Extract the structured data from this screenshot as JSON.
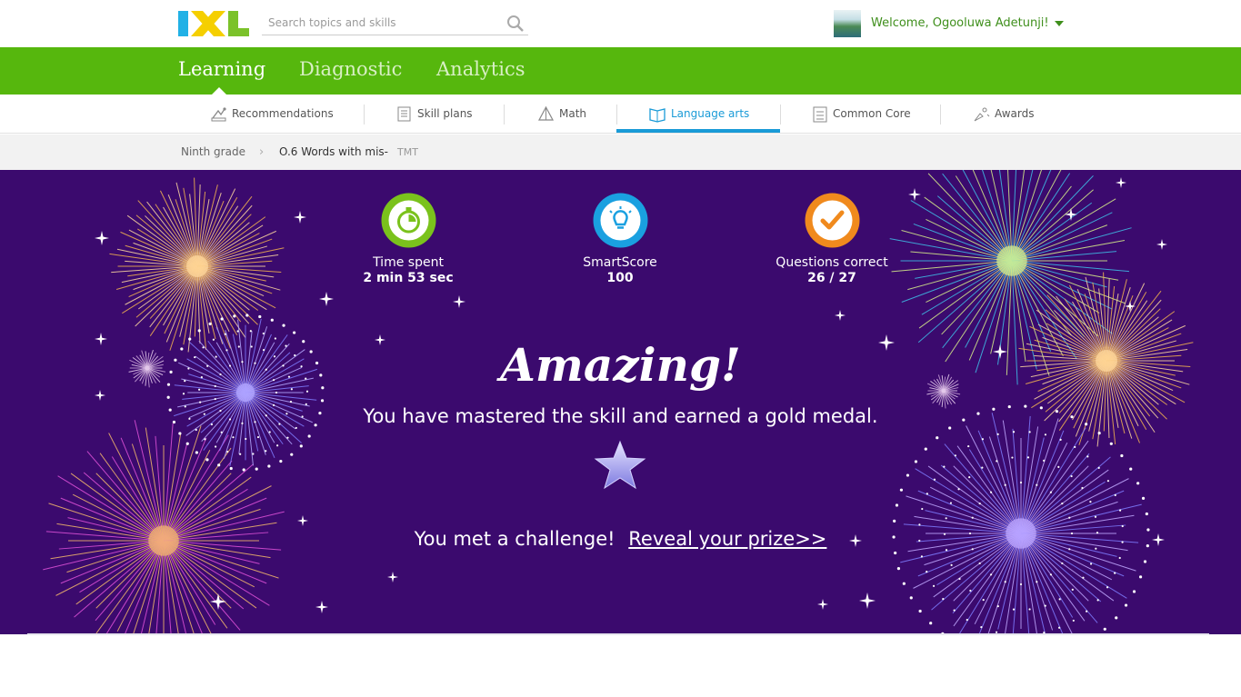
{
  "header": {
    "logo_text": "IXL",
    "search_placeholder": "Search topics and skills",
    "welcome": "Welcome, Ogooluwa Adetunji!"
  },
  "main_nav": [
    {
      "label": "Learning",
      "active": true
    },
    {
      "label": "Diagnostic",
      "active": false
    },
    {
      "label": "Analytics",
      "active": false
    }
  ],
  "sub_nav": [
    {
      "label": "Recommendations",
      "icon": "recommendations-icon"
    },
    {
      "label": "Skill plans",
      "icon": "skill-plans-icon"
    },
    {
      "label": "Math",
      "icon": "math-pyramid-icon"
    },
    {
      "label": "Language arts",
      "icon": "book-icon",
      "active": true
    },
    {
      "label": "Common Core",
      "icon": "checklist-icon"
    },
    {
      "label": "Awards",
      "icon": "awards-icon"
    }
  ],
  "breadcrumb": {
    "grade": "Ninth grade",
    "skill": "O.6 Words with mis-",
    "code": "TMT"
  },
  "stats": [
    {
      "label": "Time spent",
      "value": "2 min 53 sec",
      "icon": "stopwatch-icon",
      "color": "#7ac21c"
    },
    {
      "label": "SmartScore",
      "value": "100",
      "icon": "lightbulb-icon",
      "color": "#1aa0e0"
    },
    {
      "label": "Questions correct",
      "value": "26 / 27",
      "icon": "checkmark-icon",
      "color": "#f08a1d"
    }
  ],
  "result": {
    "headline": "Amazing!",
    "message": "You have mastered the skill and earned a gold medal.",
    "challenge_text": "You met a challenge!",
    "prize_link": "Reveal your prize>>"
  },
  "colors": {
    "brand_green": "#56b70d",
    "accent_blue": "#1a9bd7",
    "panel_purple": "#3b0a6e"
  }
}
